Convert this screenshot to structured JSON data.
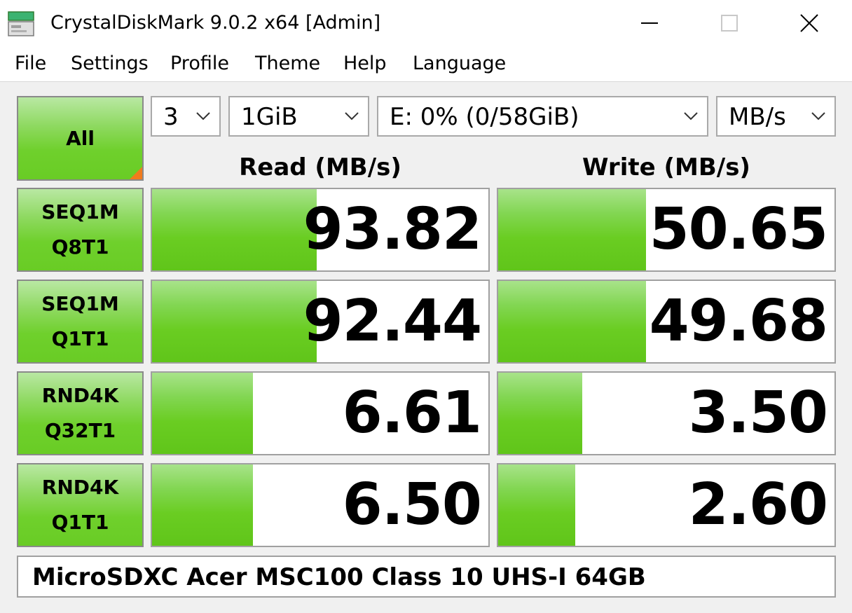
{
  "window": {
    "title": "CrystalDiskMark 9.0.2 x64 [Admin]"
  },
  "menu": [
    "File",
    "Settings",
    "Profile",
    "Theme",
    "Help",
    "Language"
  ],
  "controls": {
    "all_label": "All",
    "count": "3",
    "size": "1GiB",
    "drive": "E: 0% (0/58GiB)",
    "unit": "MB/s"
  },
  "headers": {
    "read": "Read (MB/s)",
    "write": "Write (MB/s)"
  },
  "tests": [
    {
      "line1": "SEQ1M",
      "line2": "Q8T1",
      "read": "93.82",
      "write": "50.65",
      "read_fill": 0.49,
      "write_fill": 0.44
    },
    {
      "line1": "SEQ1M",
      "line2": "Q1T1",
      "read": "92.44",
      "write": "49.68",
      "read_fill": 0.49,
      "write_fill": 0.44
    },
    {
      "line1": "RND4K",
      "line2": "Q32T1",
      "read": "6.61",
      "write": "3.50",
      "read_fill": 0.3,
      "write_fill": 0.25
    },
    {
      "line1": "RND4K",
      "line2": "Q1T1",
      "read": "6.50",
      "write": "2.60",
      "read_fill": 0.3,
      "write_fill": 0.23
    }
  ],
  "drive_label": "MicroSDXC Acer MSC100 Class 10 UHS-I 64GB",
  "colors": {
    "accent_green": "#6acd22",
    "corner_orange": "#f07b1d"
  }
}
